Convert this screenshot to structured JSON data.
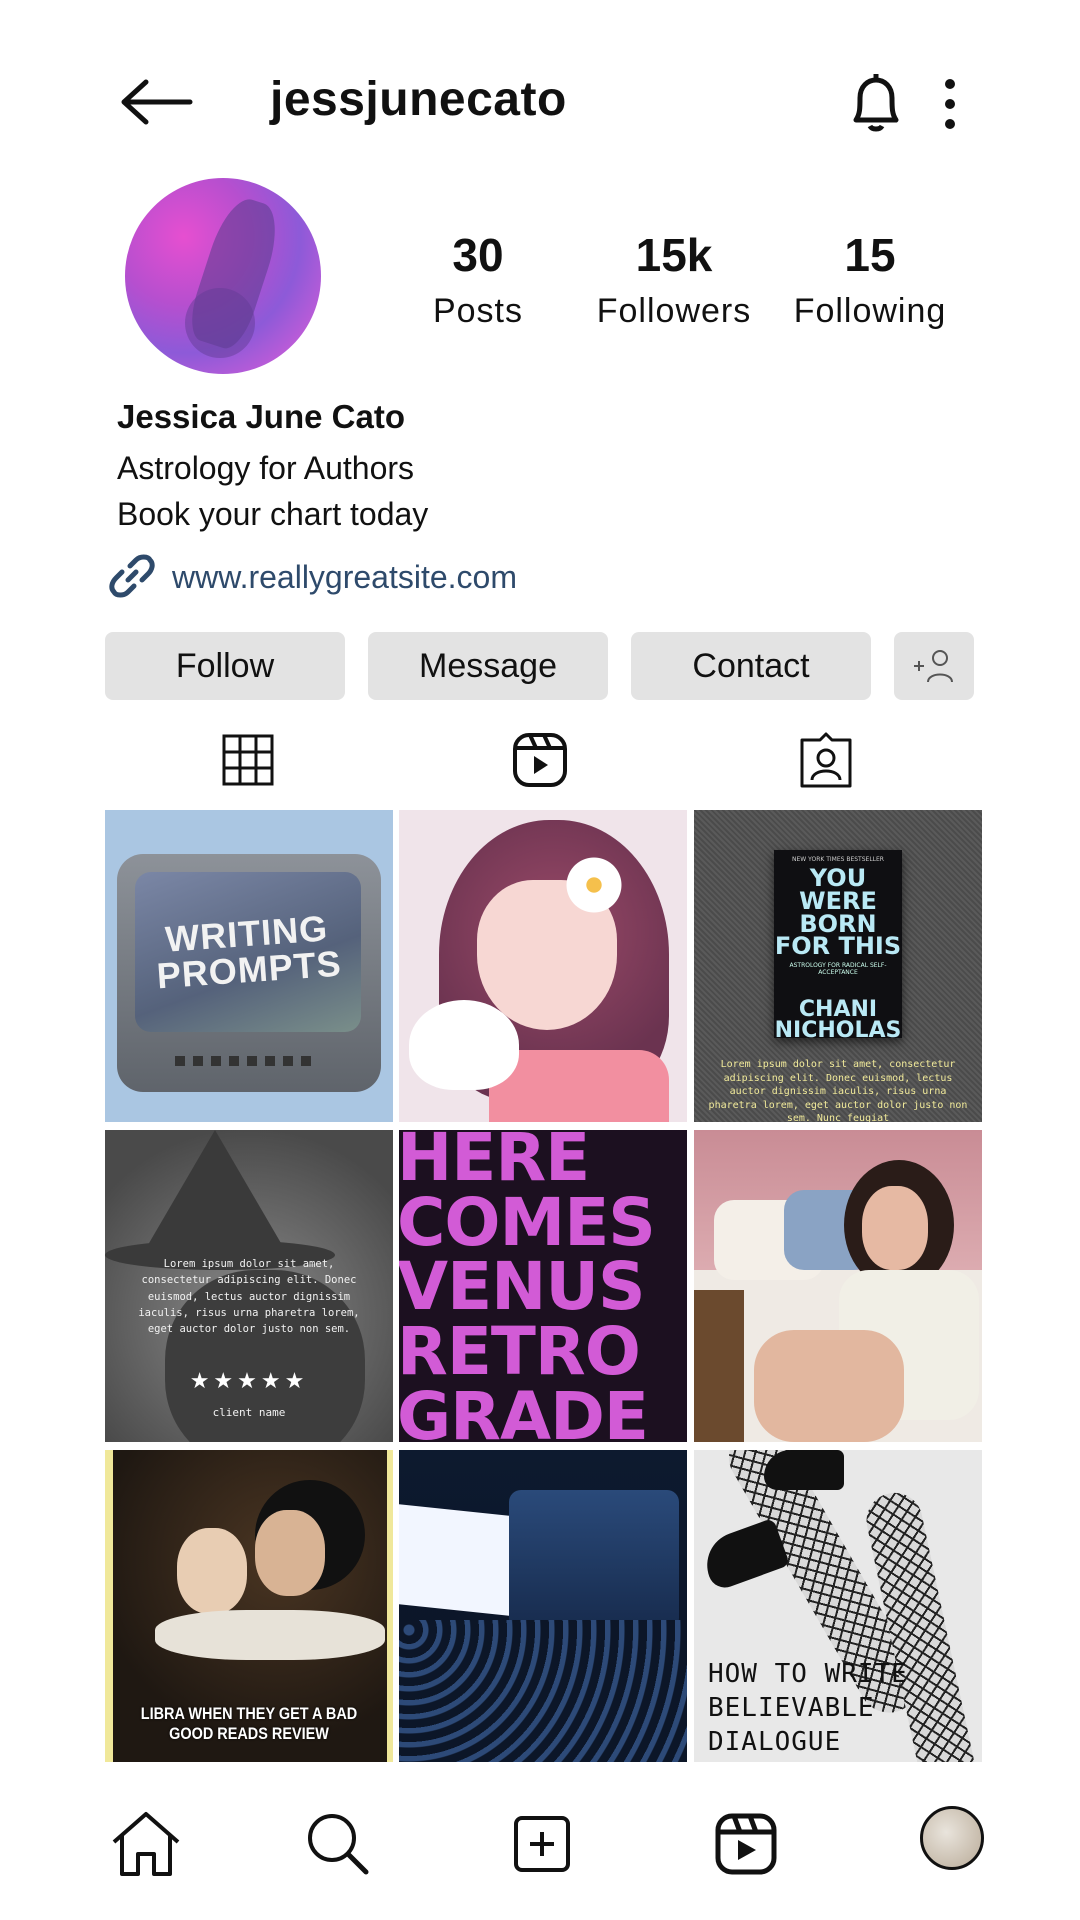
{
  "header": {
    "username": "jessjunecato"
  },
  "profile": {
    "stats": [
      {
        "value": "30",
        "label": "Posts"
      },
      {
        "value": "15k",
        "label": "Followers"
      },
      {
        "value": "15",
        "label": "Following"
      }
    ],
    "name": "Jessica June Cato",
    "bio_line1": "Astrology for Authors",
    "bio_line2": "Book your chart today",
    "link": "www.reallygreatsite.com"
  },
  "actions": {
    "follow": "Follow",
    "message": "Message",
    "contact": "Contact"
  },
  "tabs": [
    "grid-icon",
    "reels-icon",
    "tagged-icon"
  ],
  "posts": {
    "p1_text": "WRITING PROMPTS",
    "p3_book_top": "NEW YORK TIMES BESTSELLER",
    "p3_book_title": "YOU WERE BORN FOR THIS",
    "p3_book_sub": "ASTROLOGY FOR RADICAL SELF-ACCEPTANCE",
    "p3_book_author": "CHANI NICHOLAS",
    "p3_lorem": "Lorem ipsum dolor sit amet, consectetur adipiscing elit. Donec euismod, lectus auctor dignissim iaculis, risus urna pharetra lorem, eget auctor dolor justo non sem. Nunc feugiat",
    "p4_text": "Lorem ipsum dolor sit amet, consectetur adipiscing elit. Donec euismod, lectus auctor dignissim iaculis, risus urna pharetra lorem, eget auctor dolor justo non sem.",
    "p4_stars": "★★★★★",
    "p4_client": "client name",
    "p5_text": "HERE COMES VENUS RETRO GRADE",
    "p7_caption": "LIBRA WHEN THEY GET A BAD GOOD READS REVIEW",
    "p9_text": "HOW TO WRITE BELIEVABLE DIALOGUE"
  },
  "bottom_nav": [
    "home-icon",
    "search-icon",
    "create-icon",
    "reels-icon",
    "profile-avatar"
  ]
}
